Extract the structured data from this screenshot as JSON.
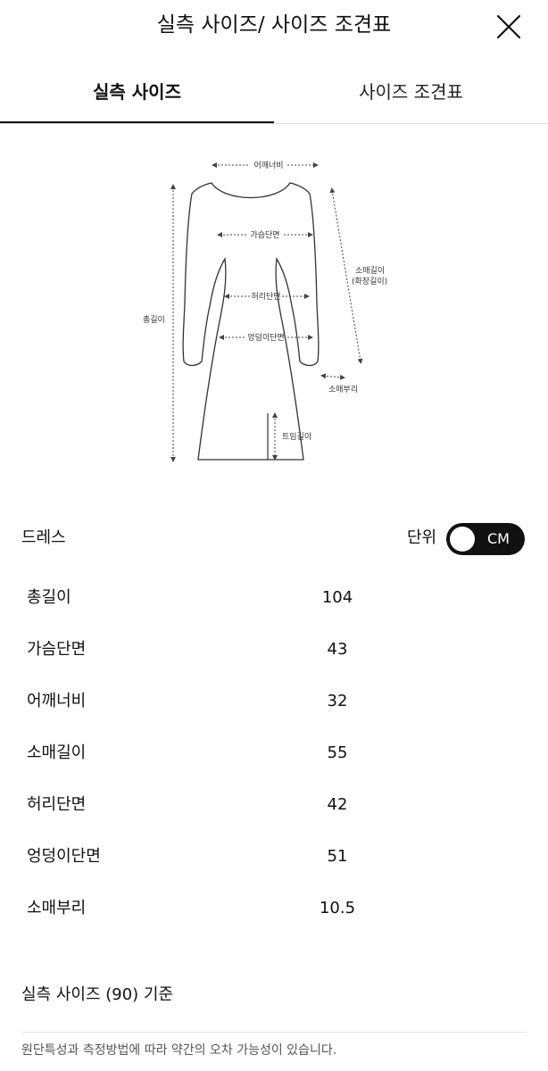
{
  "header": {
    "title": "실측 사이즈/ 사이즈 조견표",
    "close_icon": "close-icon"
  },
  "tabs": [
    {
      "label": "실측 사이즈",
      "active": true
    },
    {
      "label": "사이즈 조견표",
      "active": false
    }
  ],
  "diagram": {
    "labels": {
      "shoulder": "어깨너비",
      "chest": "가슴단면",
      "waist": "허리단면",
      "hip": "엉덩이단면",
      "total_length": "총길이",
      "sleeve_length": "소매길이",
      "sleeve_length_sub": "(화장길이)",
      "sleeve_cuff": "소매부리",
      "slit_length": "트임길이"
    }
  },
  "product": {
    "name": "드레스",
    "unit_label": "단위",
    "unit_value": "CM"
  },
  "measurements": [
    {
      "label": "총길이",
      "value": "104"
    },
    {
      "label": "가슴단면",
      "value": "43"
    },
    {
      "label": "어깨너비",
      "value": "32"
    },
    {
      "label": "소매길이",
      "value": "55"
    },
    {
      "label": "허리단면",
      "value": "42"
    },
    {
      "label": "엉덩이단면",
      "value": "51"
    },
    {
      "label": "소매부리",
      "value": "10.5"
    }
  ],
  "basis_text": "실측 사이즈 (90) 기준",
  "notice_text": "원단특성과 측정방법에 따라 약간의 오차 가능성이 있습니다."
}
